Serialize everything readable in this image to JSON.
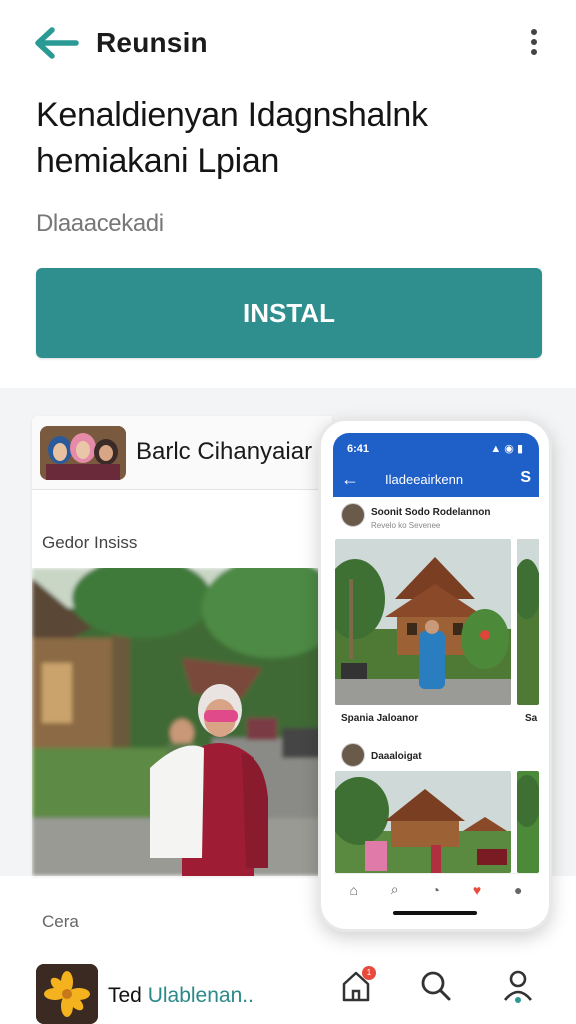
{
  "header": {
    "title": "Reunsin",
    "back_icon": "arrow-left-icon",
    "menu_icon": "more-vertical-icon"
  },
  "headline": "Kenaldienyan Idagnshalnk hemiakani Lpian",
  "subline": "Dlaaacekadi",
  "install_label": "INSTAL",
  "colors": {
    "accent": "#2f8f8f",
    "phone_header": "#1e5fc8",
    "badge": "#e84a3c"
  },
  "showcase": {
    "card_title": "Barlc Cihanyaiar",
    "card_subtitle": "Gedor Insiss"
  },
  "phone": {
    "time": "6:41",
    "screen_title": "Iladeeairkenn",
    "post1_name": "Soonit Sodo Rodelannon",
    "post1_meta": "Revelo ko Sevenee",
    "post1_caption": "Spania Jaloanor",
    "post1_caption_right": "Sa",
    "post2_name": "Daaaloigat"
  },
  "bottom": {
    "section_label": "Cera",
    "app_name_prefix": "Ted",
    "app_name_highlight": "Ulablenan.."
  },
  "nav_badge": "1"
}
